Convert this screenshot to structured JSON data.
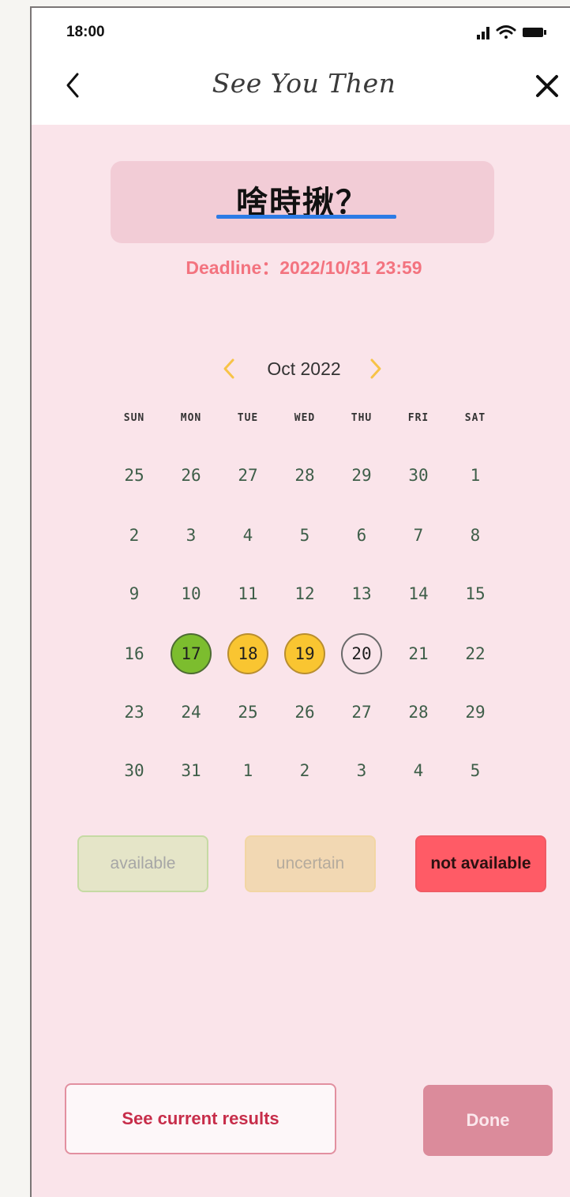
{
  "status_bar": {
    "time": "18:00"
  },
  "nav": {
    "title": "See You Then"
  },
  "question": {
    "text": "啥時揪？"
  },
  "deadline": "Deadline：2022/10/31 23:59",
  "calendar": {
    "month_label": "Oct 2022",
    "weekdays": [
      "SUN",
      "MON",
      "TUE",
      "WED",
      "THU",
      "FRI",
      "SAT"
    ],
    "weeks": [
      [
        {
          "d": "25"
        },
        {
          "d": "26"
        },
        {
          "d": "27"
        },
        {
          "d": "28"
        },
        {
          "d": "29"
        },
        {
          "d": "30"
        },
        {
          "d": "1"
        }
      ],
      [
        {
          "d": "2"
        },
        {
          "d": "3"
        },
        {
          "d": "4"
        },
        {
          "d": "5"
        },
        {
          "d": "6"
        },
        {
          "d": "7"
        },
        {
          "d": "8"
        }
      ],
      [
        {
          "d": "9"
        },
        {
          "d": "10"
        },
        {
          "d": "11"
        },
        {
          "d": "12"
        },
        {
          "d": "13"
        },
        {
          "d": "14"
        },
        {
          "d": "15"
        }
      ],
      [
        {
          "d": "16"
        },
        {
          "d": "17",
          "s": "green"
        },
        {
          "d": "18",
          "s": "yellow"
        },
        {
          "d": "19",
          "s": "yellow"
        },
        {
          "d": "20",
          "s": "outline"
        },
        {
          "d": "21"
        },
        {
          "d": "22"
        }
      ],
      [
        {
          "d": "23"
        },
        {
          "d": "24"
        },
        {
          "d": "25"
        },
        {
          "d": "26"
        },
        {
          "d": "27"
        },
        {
          "d": "28"
        },
        {
          "d": "29"
        }
      ],
      [
        {
          "d": "30"
        },
        {
          "d": "31"
        },
        {
          "d": "1"
        },
        {
          "d": "2"
        },
        {
          "d": "3"
        },
        {
          "d": "4"
        },
        {
          "d": "5"
        }
      ]
    ]
  },
  "legend": {
    "available": "available",
    "uncertain": "uncertain",
    "not_available": "not available"
  },
  "footer": {
    "results_label": "See current results",
    "done_label": "Done"
  },
  "colors": {
    "background": "#fae4ea",
    "available": "#7cbd2e",
    "uncertain": "#f9c531",
    "not_available": "#ff5b66",
    "accent": "#db8b9b"
  }
}
